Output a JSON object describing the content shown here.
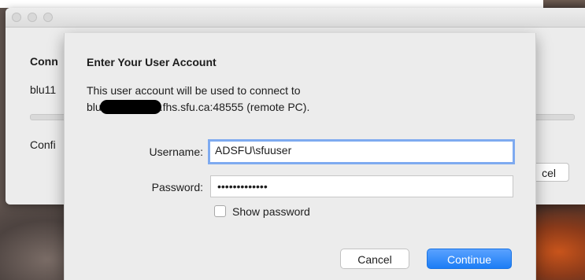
{
  "back_window": {
    "heading": "Conn",
    "host_prefix": "blu11",
    "status_prefix": "Confi",
    "cancel_partial": "cel"
  },
  "sheet": {
    "title": "Enter Your User Account",
    "message_line1": "This user account will be used to connect to",
    "host_prefix": "blu",
    "host_suffix": ".fhs.sfu.ca:48555 (remote PC).",
    "username_label": "Username:",
    "username_value": "ADSFU\\sfuuser",
    "password_label": "Password:",
    "password_value": "•••••••••••••",
    "show_password_label": "Show password",
    "show_password_checked": false,
    "cancel_label": "Cancel",
    "continue_label": "Continue"
  },
  "colors": {
    "accent": "#1c7df5",
    "focus_ring": "#7eaaf0"
  }
}
